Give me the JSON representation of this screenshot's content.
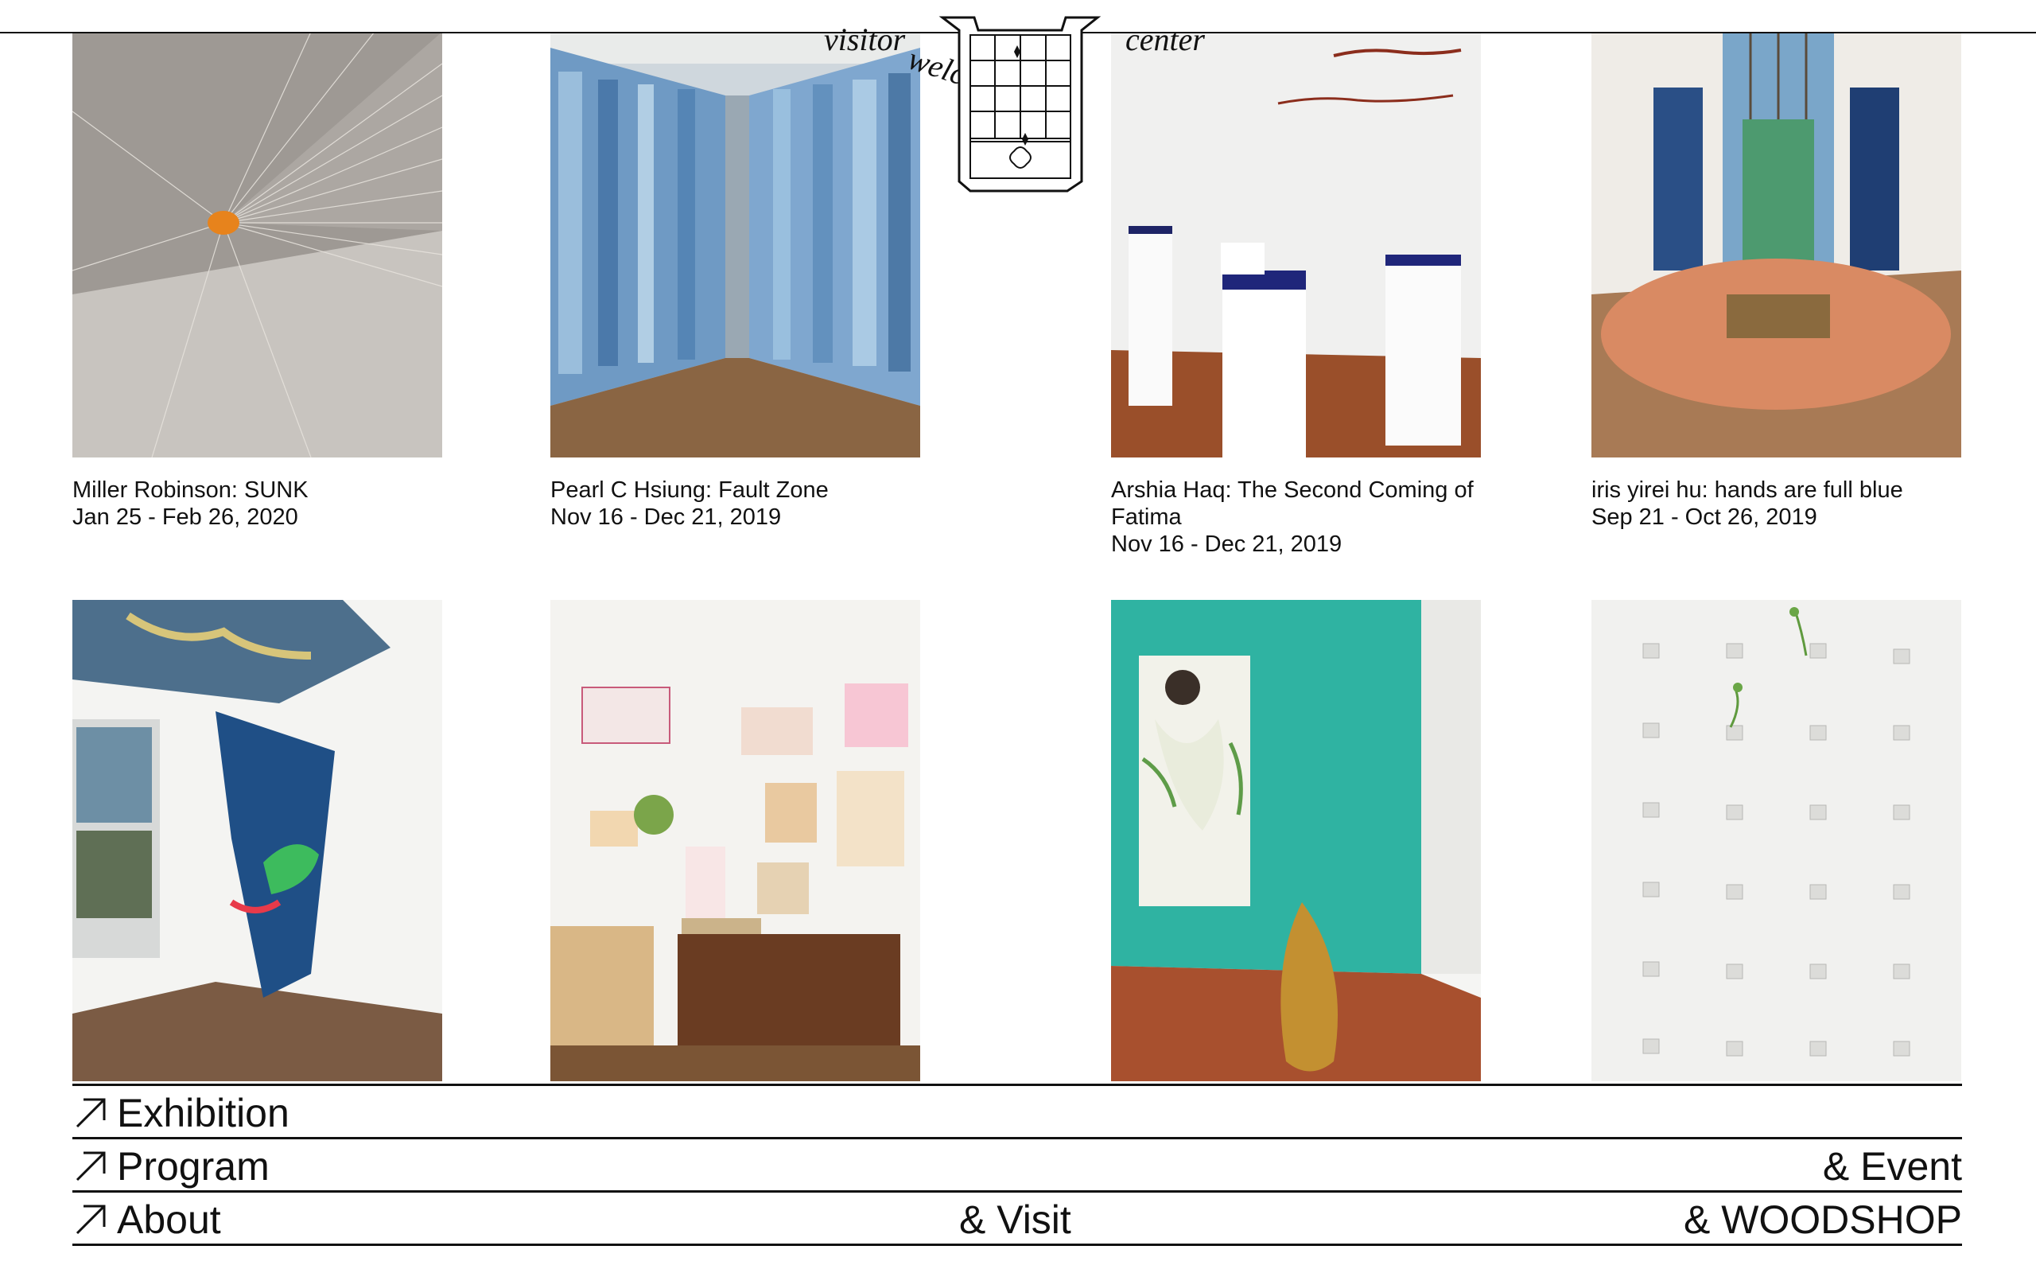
{
  "logo": {
    "word_1": "visitor",
    "word_2": "welcome",
    "word_3": "center"
  },
  "exhibitions": [
    {
      "title": "Miller Robinson: SUNK",
      "dates": "Jan 25 - Feb 26, 2020"
    },
    {
      "title": "Pearl C Hsiung: Fault Zone",
      "dates": "Nov 16 - Dec 21, 2019"
    },
    {
      "title": "Arshia Haq: The Second Coming of Fatima",
      "dates": "Nov 16 - Dec 21, 2019"
    },
    {
      "title": "iris yirei hu: hands are full blue",
      "dates": "Sep 21 - Oct 26, 2019"
    }
  ],
  "footer_nav": {
    "exhibition": "Exhibition",
    "program": "Program",
    "event": "& Event",
    "about": "About",
    "visit": "& Visit",
    "woodshop": "& WOODSHOP"
  },
  "colors": {
    "text": "#111111",
    "background": "#ffffff"
  }
}
